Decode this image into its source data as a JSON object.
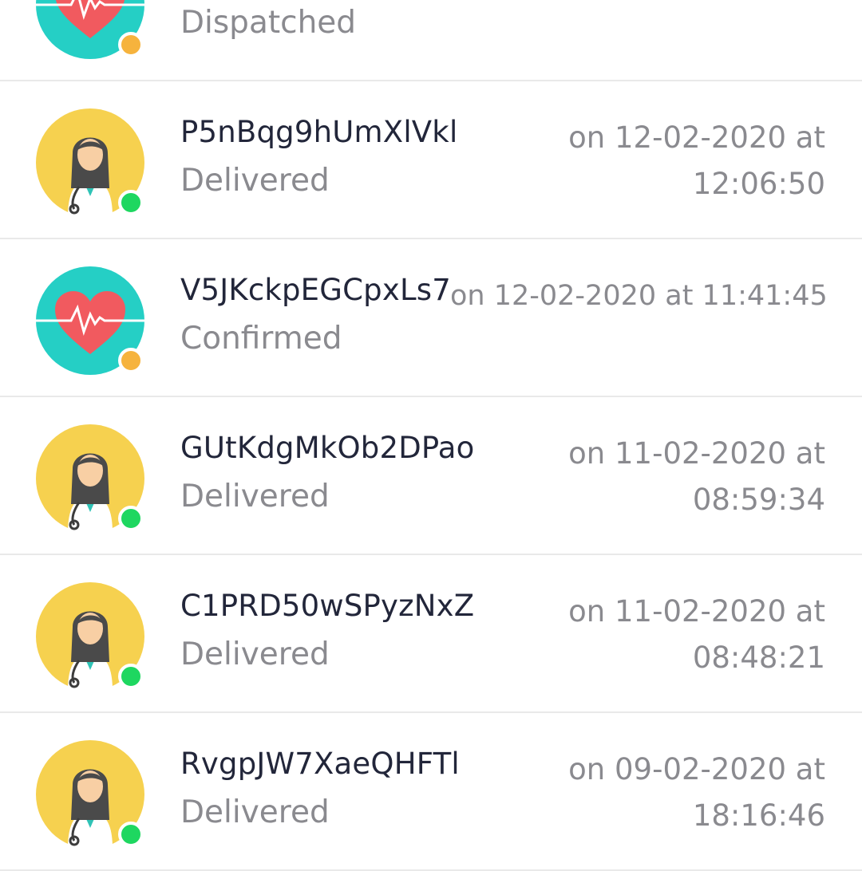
{
  "colors": {
    "status_orange": "#f6b33d",
    "status_green": "#1ed760",
    "heart_bg": "#25cfc5",
    "doctor_bg": "#f6d14f"
  },
  "orders": [
    {
      "title": "",
      "status": "Dispatched",
      "time": "",
      "avatar": "heart-icon",
      "status_color": "orange"
    },
    {
      "title": "P5nBqg9hUmXlVkl",
      "status": "Delivered",
      "time": "on 12-02-2020 at 12:06:50",
      "avatar": "doctor-avatar",
      "status_color": "green"
    },
    {
      "title": "V5JKckpEGCpxLs7",
      "status": "Confirmed",
      "time": "on 12-02-2020 at 11:41:45",
      "avatar": "heart-icon",
      "status_color": "orange"
    },
    {
      "title": "GUtKdgMkOb2DPao",
      "status": "Delivered",
      "time": "on 11-02-2020 at 08:59:34",
      "avatar": "doctor-avatar",
      "status_color": "green"
    },
    {
      "title": "C1PRD50wSPyzNxZ",
      "status": "Delivered",
      "time": "on 11-02-2020 at 08:48:21",
      "avatar": "doctor-avatar",
      "status_color": "green"
    },
    {
      "title": "RvgpJW7XaeQHFTl",
      "status": "Delivered",
      "time": "on 09-02-2020 at 18:16:46",
      "avatar": "doctor-avatar",
      "status_color": "green"
    }
  ]
}
